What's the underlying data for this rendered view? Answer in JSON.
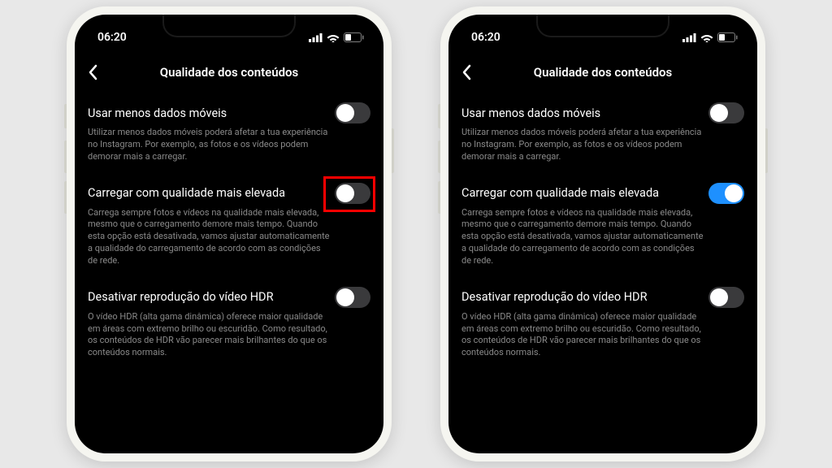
{
  "status": {
    "time": "06:20"
  },
  "header": {
    "title": "Qualidade dos conteúdos"
  },
  "settings": {
    "use_less_data": {
      "title": "Usar menos dados móveis",
      "desc": "Utilizar menos dados móveis poderá afetar a tua experiência no Instagram. Por exemplo, as fotos e os vídeos podem demorar mais a carregar."
    },
    "high_quality": {
      "title": "Carregar com qualidade mais elevada",
      "desc": "Carrega sempre fotos e vídeos na qualidade mais elevada, mesmo que o carregamento demore mais tempo. Quando esta opção está desativada, vamos ajustar automaticamente a qualidade do carregamento de acordo com as condições de rede."
    },
    "disable_hdr": {
      "title": "Desativar reprodução do vídeo HDR",
      "desc": "O vídeo HDR (alta gama dinâmica) oferece maior qualidade em áreas com extremo brilho ou escuridão. Como resultado, os conteúdos de HDR vão parecer mais brilhantes do que os conteúdos normais."
    }
  },
  "phones": {
    "left": {
      "high_quality_on": false,
      "highlight": true
    },
    "right": {
      "high_quality_on": true,
      "highlight": false
    }
  },
  "colors": {
    "accent": "#1e90ff",
    "highlight": "#ff0000"
  }
}
